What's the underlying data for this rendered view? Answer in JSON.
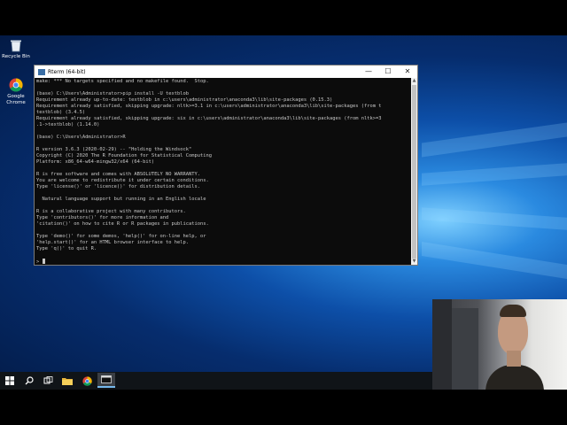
{
  "desktop": {
    "icons": [
      {
        "label": "Recycle Bin",
        "icon": "recycle-bin-icon"
      },
      {
        "label": "Google Chrome",
        "icon": "chrome-icon"
      }
    ]
  },
  "window": {
    "title": "Rterm (64-bit)",
    "controls": {
      "minimize": "—",
      "maximize": "☐",
      "close": "✕"
    }
  },
  "console": {
    "lines": [
      "make: *** No targets specified and no makefile found.  Stop.",
      "",
      "(base) C:\\Users\\Administrator>pip install -U textblob",
      "Requirement already up-to-date: textblob in c:\\users\\administrator\\anaconda3\\lib\\site-packages (0.15.3)",
      "Requirement already satisfied, skipping upgrade: nltk>=3.1 in c:\\users\\administrator\\anaconda3\\lib\\site-packages (from t",
      "textblob) (3.4.5)",
      "Requirement already satisfied, skipping upgrade: six in c:\\users\\administrator\\anaconda3\\lib\\site-packages (from nltk>=3",
      ".1->textblob) (1.14.0)",
      "",
      "(base) C:\\Users\\Administrator>R",
      "",
      "R version 3.6.3 (2020-02-29) -- \"Holding the Windsock\"",
      "Copyright (C) 2020 The R Foundation for Statistical Computing",
      "Platform: x86_64-w64-mingw32/x64 (64-bit)",
      "",
      "R is free software and comes with ABSOLUTELY NO WARRANTY.",
      "You are welcome to redistribute it under certain conditions.",
      "Type 'license()' or 'licence()' for distribution details.",
      "",
      "  Natural language support but running in an English locale",
      "",
      "R is a collaborative project with many contributors.",
      "Type 'contributors()' for more information and",
      "'citation()' on how to cite R or R packages in publications.",
      "",
      "Type 'demo()' for some demos, 'help()' for on-line help, or",
      "'help.start()' for an HTML browser interface to help.",
      "Type 'q()' to quit R.",
      ""
    ],
    "prompt": "> "
  },
  "taskbar": {
    "items": [
      "start-icon",
      "search-icon",
      "task-view-icon",
      "file-explorer-icon",
      "chrome-icon",
      "terminal-icon"
    ],
    "active": "terminal-icon"
  },
  "colors": {
    "console_bg": "#0c0c0c",
    "console_fg": "#c8c8c8",
    "taskbar": "#101418",
    "accent": "#0078d7"
  }
}
